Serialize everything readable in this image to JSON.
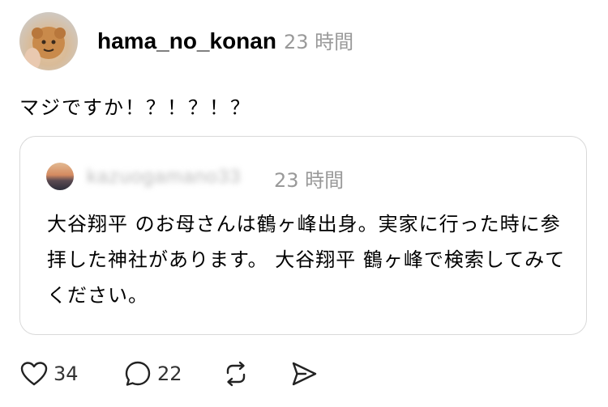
{
  "post": {
    "username": "hama_no_konan",
    "timestamp": "23 時間",
    "text": "マジですか！？！？！？"
  },
  "quote": {
    "username": "kazuogamano33",
    "timestamp": "23 時間",
    "body": "大谷翔平 のお母さんは鶴ヶ峰出身。実家に行った時に参拝した神社があります。 大谷翔平 鶴ヶ峰で検索してみてください。"
  },
  "actions": {
    "like_count": "34",
    "reply_count": "22",
    "icons": [
      "heart-icon",
      "comment-icon",
      "repost-icon",
      "share-icon"
    ]
  },
  "colors": {
    "text": "#000000",
    "secondary": "#999999",
    "border": "#d9d9d9"
  }
}
